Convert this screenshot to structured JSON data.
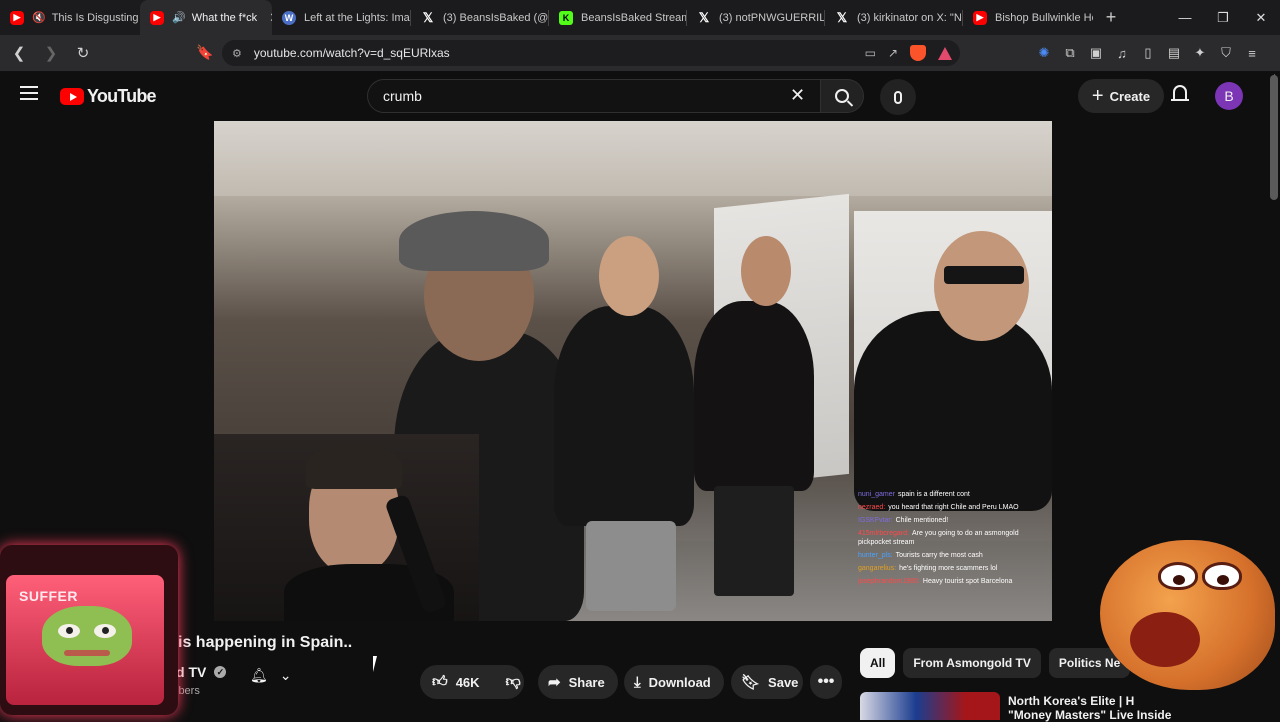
{
  "browser": {
    "tabs": [
      {
        "title": "This Is Disgusting",
        "favicon": "youtube-icon"
      },
      {
        "title": "What the f*ck",
        "favicon": "youtube-icon",
        "active": true
      },
      {
        "title": "Left at the Lights: Ima",
        "favicon": "wordpress-icon"
      },
      {
        "title": "(3) BeansIsBaked (@B",
        "favicon": "x-icon"
      },
      {
        "title": "BeansIsBaked Stream",
        "favicon": "kick-icon"
      },
      {
        "title": "(3) notPNWGUERRILL",
        "favicon": "x-icon"
      },
      {
        "title": "(3) kirkinator on X: \"N",
        "favicon": "x-icon"
      },
      {
        "title": "Bishop Bullwinkle Hel",
        "favicon": "youtube-icon"
      }
    ],
    "url": "youtube.com/watch?v=d_sqEURlxas"
  },
  "youtube": {
    "logo_text": "YouTube",
    "search_value": "crumb",
    "create_label": "Create",
    "avatar_letter": "B"
  },
  "video": {
    "title": "is happening in Spain..",
    "channel": "d TV",
    "subscribers": "ibers",
    "likes": "46K",
    "share_label": "Share",
    "download_label": "Download",
    "save_label": "Save",
    "chat": [
      {
        "user": "nuni_gamer",
        "user_color": "#7d6ce0",
        "text": "spain is a different cont"
      },
      {
        "user": "nezraed:",
        "user_color": "#ff4a4a",
        "text": "you heard that right Chile and Peru LMAO"
      },
      {
        "user": "IGSKFvtar:",
        "user_color": "#7d6ce0",
        "text": "Chile mentioned!"
      },
      {
        "user": "415mlrbcregard:",
        "user_color": "#ff4a4a",
        "text": "Are you going to do an asmongold pickpocket stream"
      },
      {
        "user": "hunter_pls:",
        "user_color": "#4aa3ff",
        "text": "Tourists carry the most cash"
      },
      {
        "user": "gangarelius:",
        "user_color": "#e0a020",
        "text": "he's fighting more scammers lol"
      },
      {
        "user": "josephrandom1980:",
        "user_color": "#ff4a4a",
        "text": "Heavy tourist spot Barcelona"
      }
    ]
  },
  "recommendations": {
    "chips": [
      "All",
      "From Asmongold TV",
      "Politics Ne"
    ],
    "first_title_line1": "North Korea's Elite | H",
    "first_title_line2": "\"Money Masters\" Live Inside"
  },
  "overlay": {
    "suffer_text": "SUFFER"
  }
}
